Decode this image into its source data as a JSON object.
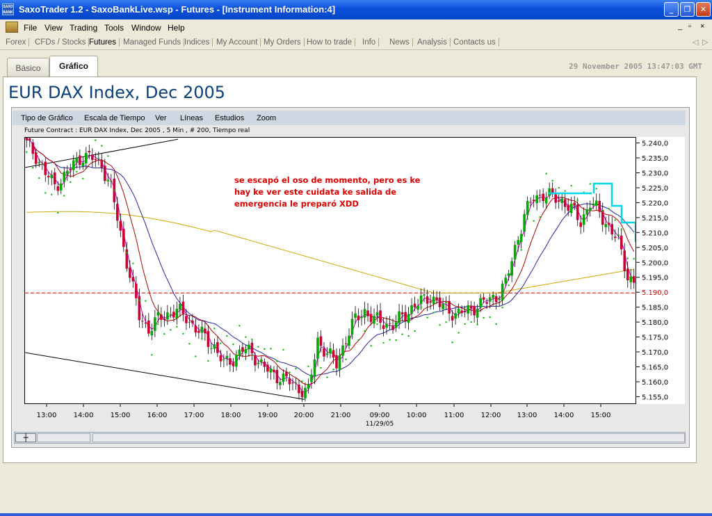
{
  "window": {
    "title": "SaxoTrader 1.2 - SaxoBankLive.wsp - Futures - [Instrument Information:4]",
    "icon_text": "SAXO BANK",
    "controls": [
      "minimize-icon",
      "maximize-icon",
      "close-icon"
    ]
  },
  "menubar": {
    "items": [
      "File",
      "View",
      "Trading",
      "Tools",
      "Window",
      "Help"
    ],
    "mdi_controls": [
      "_",
      "▫",
      "×"
    ]
  },
  "navbar": {
    "items": [
      "Forex",
      "CFDs / Stocks",
      "Futures",
      "Managed Funds",
      "Indices",
      "My Account",
      "My Orders",
      "How to trade",
      "Info",
      "News",
      "Analysis",
      "Contacts us"
    ],
    "active": "Futures",
    "arrows": [
      "◁",
      "▷"
    ]
  },
  "tabs": [
    "Básico",
    "Gráfico"
  ],
  "active_tab": "Gráfico",
  "datetime": "29 November 2005 13:47:03 GMT",
  "instrument_title": "EUR DAX Index, Dec 2005",
  "chart_toolbar": [
    "Tipo de Gráfico",
    "Escala de Tiempo",
    "Ver",
    "Líneas",
    "Estudios",
    "Zoom"
  ],
  "chart_subtitle": "Future Contract : EUR DAX Index, Dec 2005 , 5 Min , # 200, Tiempo real",
  "annotation": [
    "se escapó el oso de momento, pero es ke",
    "hay ke ver este cuidata ke salida de",
    "emergencia le preparó XDD"
  ],
  "colors": {
    "up_candle": "#00aa00",
    "down_candle": "#cc0033",
    "sma_blue": "#2323a8",
    "sma_red": "#b30000",
    "sma_yellow": "#ccaa00",
    "magenta": "#cc00cc",
    "psar": "#00bb00",
    "cyan": "#00d8e8",
    "current_price": "#cc0000"
  },
  "chart_data": {
    "type": "candlestick",
    "interval": "5 Min",
    "current_price_label": "5.190,0",
    "current_price": 5190.0,
    "y_ticks": [
      "5.240,0",
      "5.235,0",
      "5.230,0",
      "5.225,0",
      "5.220,0",
      "5.215,0",
      "5.210,0",
      "5.205,0",
      "5.200,0",
      "5.195,0",
      "5.190,0",
      "5.185,0",
      "5.180,0",
      "5.175,0",
      "5.170,0",
      "5.165,0",
      "5.160,0",
      "5.155,0"
    ],
    "y_values": [
      5240,
      5235,
      5230,
      5225,
      5220,
      5215,
      5210,
      5205,
      5200,
      5195,
      5190,
      5185,
      5180,
      5175,
      5170,
      5165,
      5160,
      5155
    ],
    "ylim": [
      5153,
      5242
    ],
    "x_ticks": [
      "13:00",
      "14:00",
      "15:00",
      "16:00",
      "17:00",
      "18:00",
      "19:00",
      "20:00",
      "21:00",
      "09:00",
      "10:00",
      "11:00",
      "12:00",
      "13:00",
      "14:00",
      "15:00"
    ],
    "x_date_label": "11/29/05",
    "close_path": [
      [
        0,
        5240
      ],
      [
        3,
        5236
      ],
      [
        6,
        5230
      ],
      [
        9,
        5226
      ],
      [
        12,
        5229
      ],
      [
        15,
        5233
      ],
      [
        18,
        5236
      ],
      [
        21,
        5235
      ],
      [
        24,
        5233
      ],
      [
        27,
        5225
      ],
      [
        30,
        5210
      ],
      [
        33,
        5196
      ],
      [
        36,
        5182
      ],
      [
        39,
        5178
      ],
      [
        42,
        5181
      ],
      [
        45,
        5183
      ],
      [
        48,
        5184
      ],
      [
        51,
        5182
      ],
      [
        54,
        5178
      ],
      [
        57,
        5175
      ],
      [
        60,
        5172
      ],
      [
        63,
        5166
      ],
      [
        66,
        5168
      ],
      [
        69,
        5171
      ],
      [
        72,
        5170
      ],
      [
        75,
        5166
      ],
      [
        78,
        5163
      ],
      [
        81,
        5162
      ],
      [
        84,
        5160
      ],
      [
        87,
        5158
      ],
      [
        90,
        5157
      ],
      [
        93,
        5174
      ],
      [
        96,
        5170
      ],
      [
        99,
        5166
      ],
      [
        102,
        5175
      ],
      [
        105,
        5181
      ],
      [
        108,
        5184
      ],
      [
        111,
        5181
      ],
      [
        114,
        5180
      ],
      [
        117,
        5179
      ],
      [
        120,
        5182
      ],
      [
        123,
        5185
      ],
      [
        126,
        5187
      ],
      [
        129,
        5189
      ],
      [
        132,
        5186
      ],
      [
        135,
        5184
      ],
      [
        138,
        5183
      ],
      [
        141,
        5184
      ],
      [
        144,
        5186
      ],
      [
        147,
        5187
      ],
      [
        150,
        5189
      ],
      [
        153,
        5193
      ],
      [
        156,
        5205
      ],
      [
        159,
        5216
      ],
      [
        162,
        5222
      ],
      [
        165,
        5223
      ],
      [
        168,
        5222
      ],
      [
        171,
        5221
      ],
      [
        174,
        5218
      ],
      [
        177,
        5214
      ],
      [
        180,
        5220
      ],
      [
        183,
        5217
      ],
      [
        186,
        5212
      ],
      [
        189,
        5207
      ],
      [
        192,
        5196
      ],
      [
        194,
        5193
      ]
    ]
  }
}
